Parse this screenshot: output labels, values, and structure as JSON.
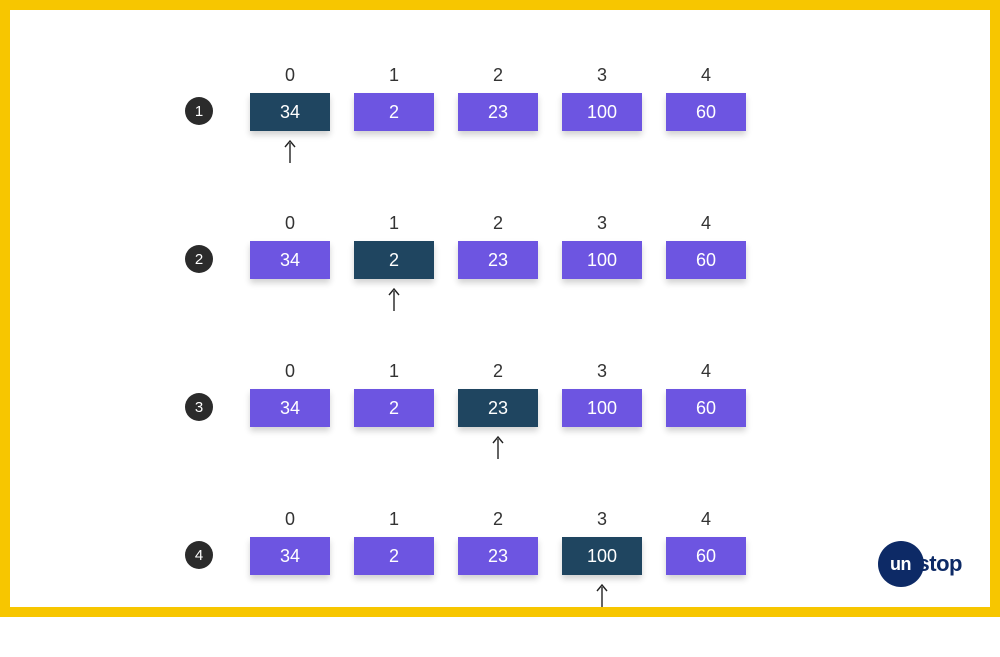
{
  "diagram": {
    "rows": [
      {
        "step": "1",
        "highlight_index": 0,
        "cells": [
          {
            "index": "0",
            "value": "34"
          },
          {
            "index": "1",
            "value": "2"
          },
          {
            "index": "2",
            "value": "23"
          },
          {
            "index": "3",
            "value": "100"
          },
          {
            "index": "4",
            "value": "60"
          }
        ]
      },
      {
        "step": "2",
        "highlight_index": 1,
        "cells": [
          {
            "index": "0",
            "value": "34"
          },
          {
            "index": "1",
            "value": "2"
          },
          {
            "index": "2",
            "value": "23"
          },
          {
            "index": "3",
            "value": "100"
          },
          {
            "index": "4",
            "value": "60"
          }
        ]
      },
      {
        "step": "3",
        "highlight_index": 2,
        "cells": [
          {
            "index": "0",
            "value": "34"
          },
          {
            "index": "1",
            "value": "2"
          },
          {
            "index": "2",
            "value": "23"
          },
          {
            "index": "3",
            "value": "100"
          },
          {
            "index": "4",
            "value": "60"
          }
        ]
      },
      {
        "step": "4",
        "highlight_index": 3,
        "cells": [
          {
            "index": "0",
            "value": "34"
          },
          {
            "index": "1",
            "value": "2"
          },
          {
            "index": "2",
            "value": "23"
          },
          {
            "index": "3",
            "value": "100"
          },
          {
            "index": "4",
            "value": "60"
          }
        ]
      }
    ]
  },
  "brand": {
    "circle_text": "un",
    "rest_text": "stop"
  },
  "colors": {
    "border": "#f7c600",
    "cell_normal": "#6d55e1",
    "cell_highlight": "#1f4560",
    "badge_bg": "#2b2b2b",
    "brand": "#0d2a66"
  }
}
